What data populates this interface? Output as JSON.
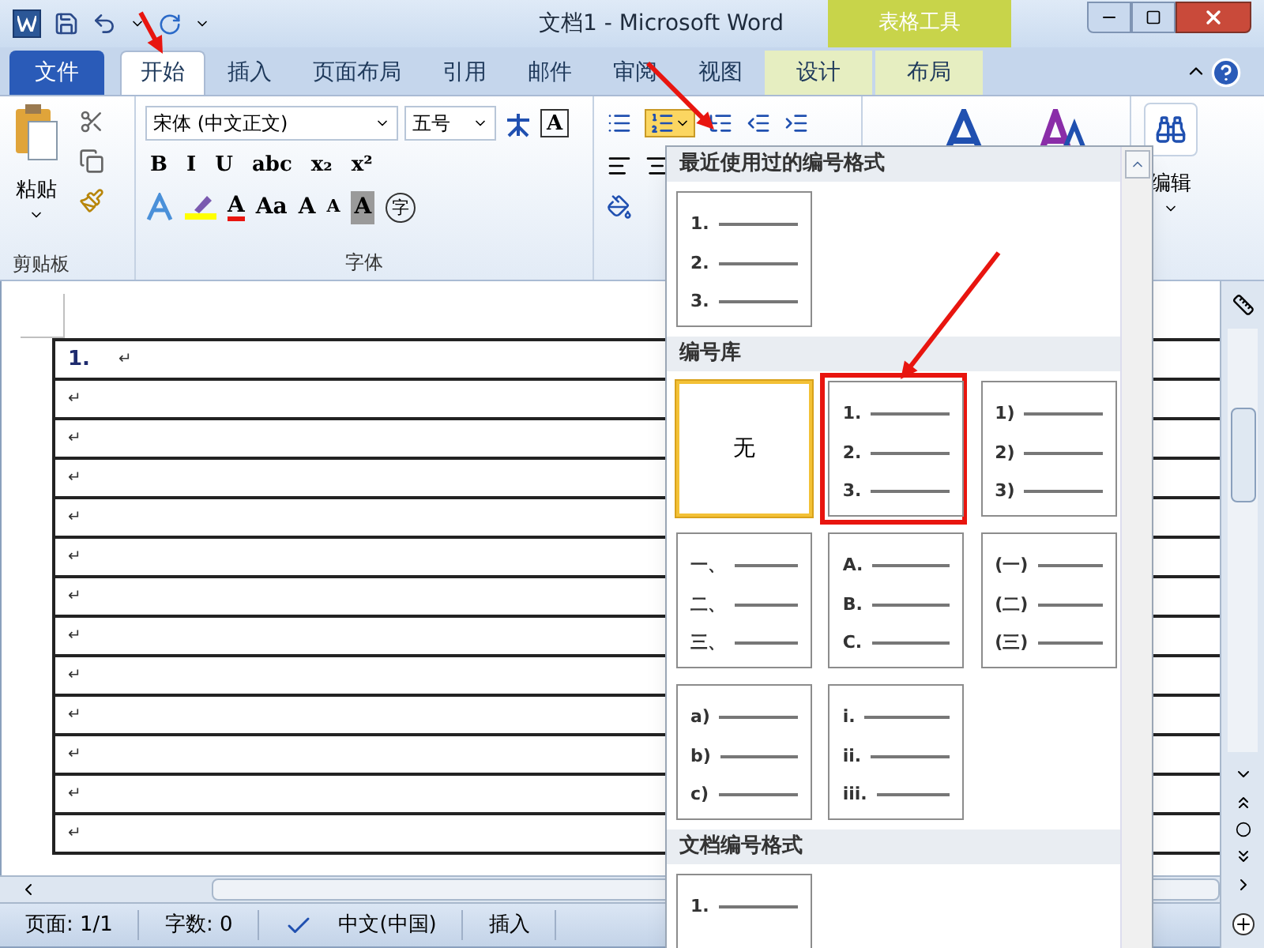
{
  "window": {
    "title": "文档1 - Microsoft Word"
  },
  "contextual_group": {
    "label": "表格工具"
  },
  "tabs": [
    {
      "label": "文件",
      "kind": "file",
      "selected": false
    },
    {
      "label": "开始",
      "kind": "normal",
      "selected": true
    },
    {
      "label": "插入",
      "kind": "normal",
      "selected": false
    },
    {
      "label": "页面布局",
      "kind": "normal",
      "selected": false
    },
    {
      "label": "引用",
      "kind": "normal",
      "selected": false
    },
    {
      "label": "邮件",
      "kind": "normal",
      "selected": false
    },
    {
      "label": "审阅",
      "kind": "normal",
      "selected": false
    },
    {
      "label": "视图",
      "kind": "normal",
      "selected": false
    },
    {
      "label": "设计",
      "kind": "contextual",
      "selected": false
    },
    {
      "label": "布局",
      "kind": "contextual",
      "selected": false
    }
  ],
  "ribbon": {
    "paste_label": "粘贴",
    "clipboard_label": "剪贴板",
    "font_label": "字体",
    "font_name": "宋体 (中文正文)",
    "font_size": "五号",
    "border_char": "A",
    "format_row": [
      "B",
      "I",
      "U",
      "abc",
      "x₂",
      "x²"
    ],
    "font_color_char": "A",
    "case_label": "Aa",
    "grow_char": "A",
    "shrink_char": "A",
    "shading_char": "A",
    "enclose_char": "字",
    "edit_label": "编辑"
  },
  "document": {
    "rows": [
      {
        "number": "1.",
        "mark": "↵"
      },
      {
        "mark": "↵"
      },
      {
        "mark": "↵"
      },
      {
        "mark": "↵"
      },
      {
        "mark": "↵"
      },
      {
        "mark": "↵"
      },
      {
        "mark": "↵"
      },
      {
        "mark": "↵"
      },
      {
        "mark": "↵"
      },
      {
        "mark": "↵"
      },
      {
        "mark": "↵"
      },
      {
        "mark": "↵"
      },
      {
        "mark": "↵"
      }
    ]
  },
  "numbering_menu": {
    "sections": [
      {
        "title": "最近使用过的编号格式",
        "items": [
          {
            "kind": "list",
            "selected": false,
            "marked": false,
            "lines": [
              "1.",
              "2.",
              "3."
            ]
          }
        ]
      },
      {
        "title": "编号库",
        "items": [
          {
            "kind": "none",
            "label": "无",
            "selected": true,
            "marked": false
          },
          {
            "kind": "list",
            "selected": false,
            "marked": true,
            "lines": [
              "1.",
              "2.",
              "3."
            ]
          },
          {
            "kind": "list",
            "selected": false,
            "marked": false,
            "lines": [
              "1)",
              "2)",
              "3)"
            ]
          },
          {
            "kind": "list",
            "selected": false,
            "marked": false,
            "lines": [
              "一、",
              "二、",
              "三、"
            ]
          },
          {
            "kind": "list",
            "selected": false,
            "marked": false,
            "lines": [
              "A.",
              "B.",
              "C."
            ]
          },
          {
            "kind": "list",
            "selected": false,
            "marked": false,
            "lines": [
              "(一)",
              "(二)",
              "(三)"
            ]
          },
          {
            "kind": "list",
            "selected": false,
            "marked": false,
            "lines": [
              "a)",
              "b)",
              "c)"
            ]
          },
          {
            "kind": "list",
            "selected": false,
            "marked": false,
            "lines": [
              "i.",
              "ii.",
              "iii."
            ]
          }
        ]
      },
      {
        "title": "文档编号格式",
        "items": [
          {
            "kind": "list",
            "selected": false,
            "marked": false,
            "lines": [
              "1."
            ]
          }
        ]
      }
    ]
  },
  "status_bar": {
    "page": "页面: 1/1",
    "words": "字数: 0",
    "language": "中文(中国)",
    "mode": "插入"
  }
}
